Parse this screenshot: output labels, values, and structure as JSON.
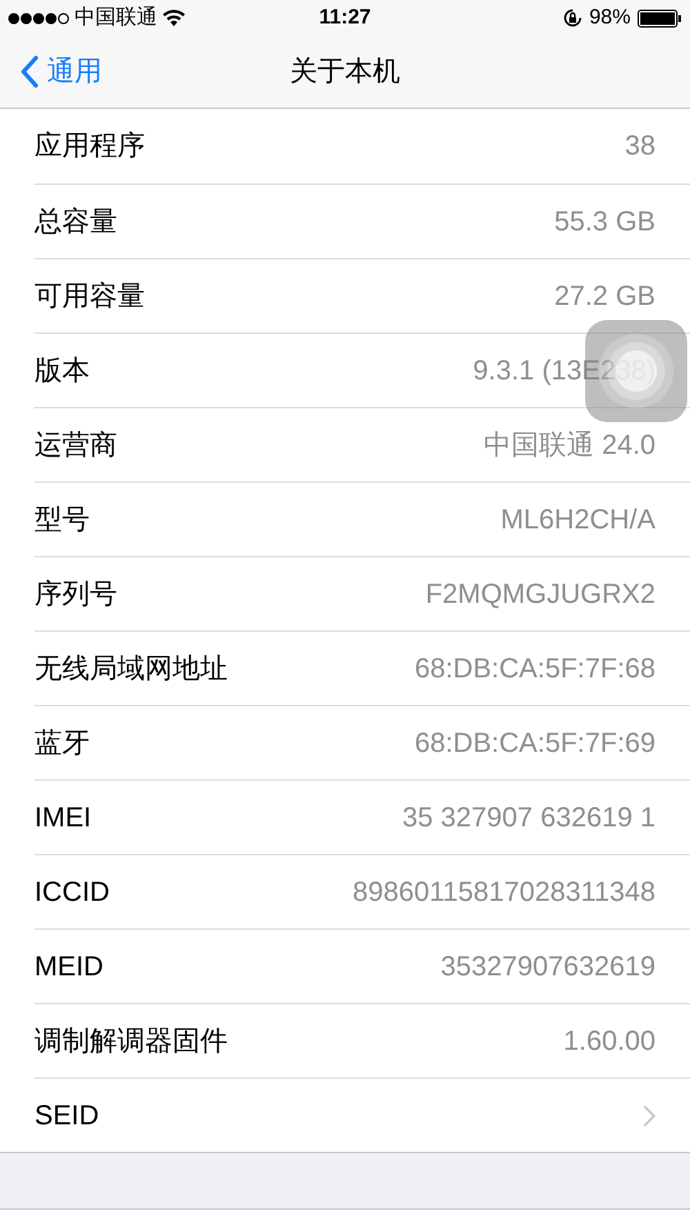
{
  "status_bar": {
    "carrier": "中国联通",
    "time": "11:27",
    "battery": "98%"
  },
  "nav": {
    "back": "通用",
    "title": "关于本机"
  },
  "rows": [
    {
      "kind": "value",
      "label": "应用程序",
      "value": "38"
    },
    {
      "kind": "value",
      "label": "总容量",
      "value": "55.3 GB"
    },
    {
      "kind": "value",
      "label": "可用容量",
      "value": "27.2 GB"
    },
    {
      "kind": "value",
      "label": "版本",
      "value": "9.3.1 (13E238)"
    },
    {
      "kind": "value",
      "label": "运营商",
      "value": "中国联通 24.0"
    },
    {
      "kind": "value",
      "label": "型号",
      "value": "ML6H2CH/A"
    },
    {
      "kind": "value",
      "label": "序列号",
      "value": "F2MQMGJUGRX2"
    },
    {
      "kind": "value",
      "label": "无线局域网地址",
      "value": "68:DB:CA:5F:7F:68"
    },
    {
      "kind": "value",
      "label": "蓝牙",
      "value": "68:DB:CA:5F:7F:69"
    },
    {
      "kind": "value",
      "label": "IMEI",
      "value": "35 327907 632619 1"
    },
    {
      "kind": "value",
      "label": "ICCID",
      "value": "89860115817028311348"
    },
    {
      "kind": "value",
      "label": "MEID",
      "value": "35327907632619"
    },
    {
      "kind": "value",
      "label": "调制解调器固件",
      "value": "1.60.00"
    },
    {
      "kind": "link",
      "label": "SEID"
    }
  ]
}
